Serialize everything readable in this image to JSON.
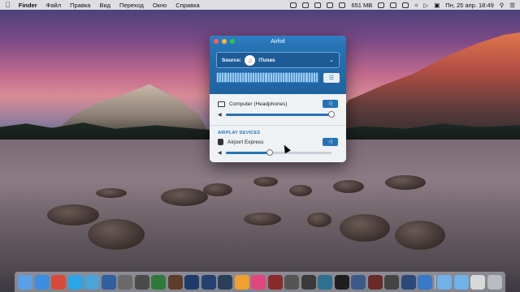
{
  "menubar": {
    "app": "Finder",
    "items": [
      "Файл",
      "Правка",
      "Вид",
      "Переход",
      "Окно",
      "Справка"
    ],
    "memory": "651 MB",
    "datetime": "Пн, 25 апр.  18:49"
  },
  "window": {
    "title": "Airfoil",
    "source_label": "Source:",
    "source_name": "iTunes",
    "local_device": "Computer (Headphones)",
    "local_volume_percent": 100,
    "section_heading": "AIRPLAY DEVICES",
    "airplay_device": "Airport Express",
    "airplay_volume_percent": 42
  },
  "dock": {
    "icons": [
      {
        "name": "finder-icon",
        "color": "#5aa0e6"
      },
      {
        "name": "safari-icon",
        "color": "#3b8ee0"
      },
      {
        "name": "chrome-icon",
        "color": "#d9493b"
      },
      {
        "name": "skype-icon",
        "color": "#2aa5e8"
      },
      {
        "name": "telegram-icon",
        "color": "#4aa3d9"
      },
      {
        "name": "app-icon",
        "color": "#2f5f9e"
      },
      {
        "name": "app-icon",
        "color": "#6a6a6a"
      },
      {
        "name": "app-icon",
        "color": "#4a4a4a"
      },
      {
        "name": "app-icon",
        "color": "#2e7a3a"
      },
      {
        "name": "app-icon",
        "color": "#5b3d2a"
      },
      {
        "name": "photoshop-icon",
        "color": "#1f3b6b"
      },
      {
        "name": "photoshop-icon",
        "color": "#24416f"
      },
      {
        "name": "lightroom-icon",
        "color": "#2b3f5a"
      },
      {
        "name": "photos-icon",
        "color": "#f0a030"
      },
      {
        "name": "itunes-icon",
        "color": "#e2467e"
      },
      {
        "name": "app-icon",
        "color": "#8a2b2b"
      },
      {
        "name": "app-icon",
        "color": "#555555"
      },
      {
        "name": "app-icon",
        "color": "#3a3a3a"
      },
      {
        "name": "app-icon",
        "color": "#2f6f8f"
      },
      {
        "name": "app-icon",
        "color": "#1f1f1f"
      },
      {
        "name": "app-icon",
        "color": "#3a5a8a"
      },
      {
        "name": "app-icon",
        "color": "#6a2a2a"
      },
      {
        "name": "app-icon",
        "color": "#444444"
      },
      {
        "name": "app-icon",
        "color": "#2a4a7a"
      },
      {
        "name": "app-icon",
        "color": "#3a78c8"
      },
      {
        "name": "folder-icon",
        "color": "#6fb1e8"
      },
      {
        "name": "folder-icon",
        "color": "#6fb1e8"
      },
      {
        "name": "document-icon",
        "color": "#d8d8d8"
      },
      {
        "name": "trash-icon",
        "color": "#b8bcc2"
      }
    ]
  },
  "colors": {
    "accent": "#2672b3"
  }
}
